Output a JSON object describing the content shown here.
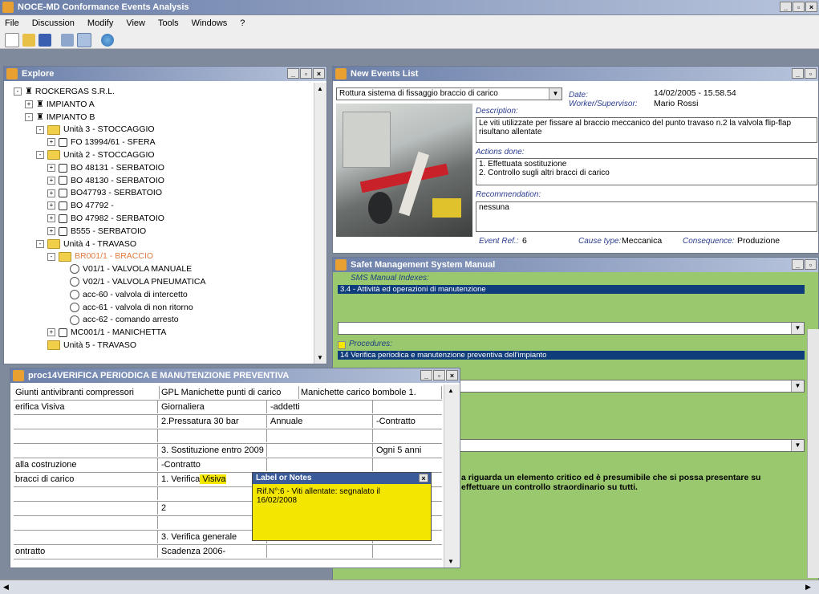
{
  "app": {
    "title": "NOCE-MD Conformance Events Analysis",
    "menu": [
      "File",
      "Discussion",
      "Modify",
      "View",
      "Tools",
      "Windows",
      "?"
    ]
  },
  "explorer": {
    "title": "Explore",
    "tree": [
      {
        "text": "ROCKERGAS  S.R.L.",
        "kind": "plant",
        "exp": "-"
      },
      {
        "text": "IMPIANTO A",
        "kind": "plant",
        "exp": "+"
      },
      {
        "text": "IMPIANTO B",
        "kind": "plant",
        "exp": "-"
      },
      {
        "text": "Unità 3 - STOCCAGGIO",
        "kind": "folder",
        "exp": "-"
      },
      {
        "text": "FO 13994/61 - SFERA",
        "kind": "node",
        "exp": "+"
      },
      {
        "text": "Unità 2 - STOCCAGGIO",
        "kind": "folder",
        "exp": "-"
      },
      {
        "text": "BO 48131 - SERBATOIO",
        "kind": "node",
        "exp": "+"
      },
      {
        "text": "BO 48130 - SERBATOIO",
        "kind": "node",
        "exp": "+"
      },
      {
        "text": "BO47793 - SERBATOIO",
        "kind": "node",
        "exp": "+"
      },
      {
        "text": "BO 47792 -",
        "kind": "node",
        "exp": "+"
      },
      {
        "text": "BO 47982 - SERBATOIO",
        "kind": "node",
        "exp": "+"
      },
      {
        "text": "B555 - SERBATOIO",
        "kind": "node",
        "exp": "+"
      },
      {
        "text": "Unità 4 - TRAVASO",
        "kind": "folder",
        "exp": "-"
      },
      {
        "text": "BR001/1 - BRACCIO",
        "kind": "folder-sel",
        "exp": "-"
      },
      {
        "text": "V01/1 - VALVOLA MANUALE",
        "kind": "circ",
        "exp": ""
      },
      {
        "text": "V02/1 - VALVOLA PNEUMATICA",
        "kind": "circ",
        "exp": ""
      },
      {
        "text": "acc-60 - valvola di intercetto",
        "kind": "circ",
        "exp": ""
      },
      {
        "text": "acc-61 - valvola di non ritorno",
        "kind": "circ",
        "exp": ""
      },
      {
        "text": "acc-62 - comando arresto",
        "kind": "circ",
        "exp": ""
      },
      {
        "text": "MC001/1 - MANICHETTA",
        "kind": "node",
        "exp": "+"
      },
      {
        "text": "Unità 5 - TRAVASO",
        "kind": "folder",
        "exp": ""
      }
    ]
  },
  "events": {
    "title": "New Events List",
    "event_select": "Rottura sistema di fissaggio braccio di carico",
    "date_label": "Date:",
    "date_value": "14/02/2005 - 15.58.54",
    "worker_label": "Worker/Supervisor:",
    "worker_value": "Mario Rossi",
    "description_label": "Description:",
    "description_value": "Le viti utilizzate per fissare al braccio meccanico del punto travaso n.2 la valvola flip-flap risultano allentate",
    "actions_label": "Actions done:",
    "actions_value_1": "1. Effettuata sostituzione",
    "actions_value_2": "2. Controllo sugli altri bracci di carico",
    "recommendation_label": "Recommendation:",
    "recommendation_value": "nessuna",
    "event_ref_label": "Event Ref.:",
    "event_ref_value": "6",
    "cause_label": "Cause type:",
    "cause_value": "Meccanica",
    "consequence_label": "Consequence:",
    "consequence_value": "Produzione"
  },
  "sms": {
    "title": "Safet Management System Manual",
    "indexes_label": "SMS Manual Indexes:",
    "index_value": "3.4 - Attività ed operazioni di manutenzione",
    "procedures_label": "Procedures:",
    "procedure_value": "14 Verifica periodica e manutenzione preventiva dell'impianto",
    "note_line_1": "a riguarda un elemento critico ed è presumibile che si possa presentare su",
    "note_line_2": "effettuare un controllo straordinario su tutti."
  },
  "proc": {
    "title": "proc14VERIFICA PERIODICA E MANUTENZIONE PREVENTIVA",
    "rows": [
      [
        "Giunti antivibranti compressori",
        "GPL   Manichette punti di carico",
        "Manichette carico bombole 1."
      ],
      [
        "erifica Visiva",
        "Giornaliera",
        "-addetti",
        ""
      ],
      [
        "",
        "2.Pressatura 30 bar",
        "Annuale",
        "-Contratto"
      ],
      [
        "",
        "",
        "",
        ""
      ],
      [
        "",
        "3. Sostituzione  entro 2009",
        "",
        "Ogni 5 anni"
      ],
      [
        "alla costruzione",
        "-Contratto",
        "",
        ""
      ],
      [
        "bracci di carico",
        "1. Verifica",
        "",
        ""
      ],
      [
        "",
        "",
        "",
        ""
      ],
      [
        "",
        "2",
        "",
        ""
      ],
      [
        "",
        "",
        "",
        ""
      ],
      [
        "",
        "3. Verifica generale",
        "",
        ""
      ],
      [
        "ontratto",
        "Scadenza 2006-",
        "",
        ""
      ]
    ],
    "visiva_highlight": "Visiva"
  },
  "note": {
    "title": "Label or Notes",
    "text_1": "Rif.N°:6 - Viti allentate: segnalato il",
    "text_2": "16/02/2008"
  },
  "colors": {
    "sms_bg": "#9ac86e",
    "index_bar": "#0f3c7a",
    "note_bg": "#f3e600",
    "note_title": "#3b5a9a",
    "highlight": "#f3e600"
  }
}
